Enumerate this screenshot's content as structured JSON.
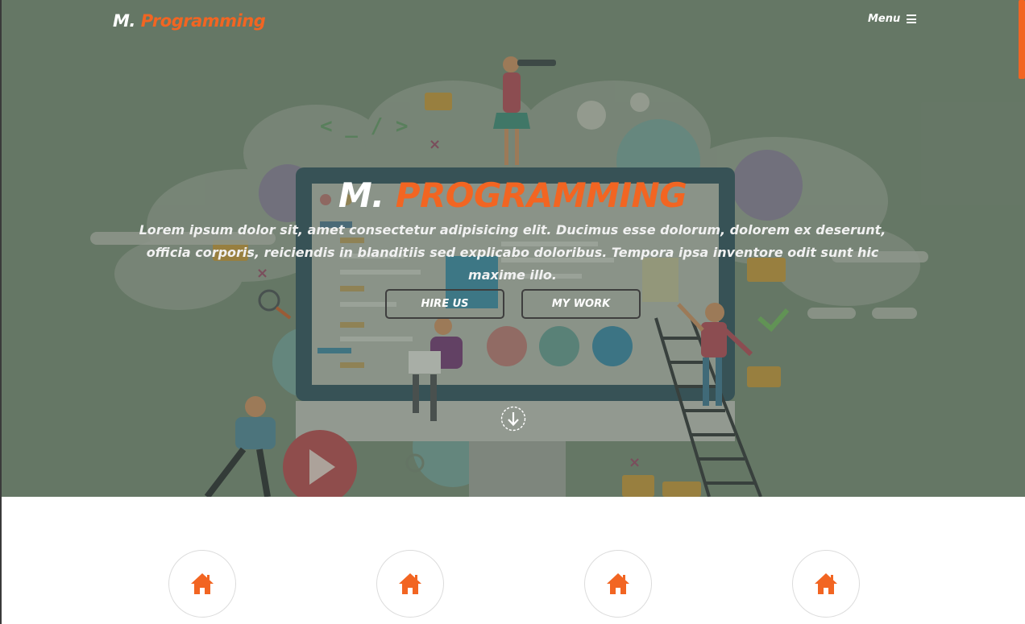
{
  "brand": {
    "prefix": "M.",
    "accent": "Programming"
  },
  "nav": {
    "menu_label": "Menu",
    "menu_icon": "hamburger-icon"
  },
  "hero": {
    "title_prefix": "M.",
    "title_accent": "PROGRAMMING",
    "text": "Lorem ipsum dolor sit, amet consectetur adipisicing elit. Ducimus esse dolorum, dolorem ex deserunt, officia corporis, reiciendis in blanditiis sed explicabo doloribus. Tempora ipsa inventore odit sunt hic maxime illo.",
    "buttons": {
      "hire_label": "HIRE US",
      "work_label": "MY WORK"
    },
    "scroll_icon": "arrow-down-circle-icon"
  },
  "features": {
    "icons": [
      "home-icon",
      "home-icon",
      "home-icon",
      "home-icon"
    ]
  },
  "colors": {
    "accent": "#f26522",
    "hero_background": "#6f7f6f",
    "button_border": "#3e3e3e",
    "text_light": "#ffffff"
  }
}
